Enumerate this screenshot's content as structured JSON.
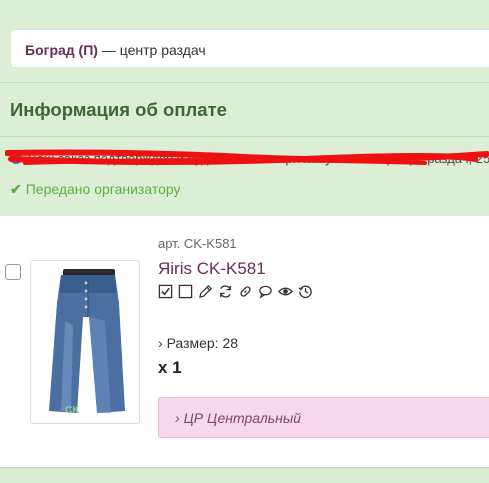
{
  "pickup": {
    "name": "Боград (П)",
    "suffix": " — центр раздач"
  },
  "payment": {
    "title": "Информация об оплате",
    "info_text": "Ваш заказ подтверждён и будет оплачен при получении в центре раздач, 25 т.р.",
    "status_text": "Передано организатору"
  },
  "item": {
    "article": "арт. CK-K581",
    "name": "Яiris CK-K581",
    "size_label": "Размер: 28",
    "quantity": "x 1",
    "pickup_zone": "ЦР Центральный",
    "icons": [
      "checked-box-icon",
      "empty-box-icon",
      "pencil-icon",
      "refresh-icon",
      "link-icon",
      "comment-icon",
      "eye-icon",
      "history-icon"
    ]
  },
  "colors": {
    "accent": "#6e2c55",
    "status": "#5bb041",
    "heading": "#3a6a32",
    "zone_bg": "#f6d8ea"
  }
}
